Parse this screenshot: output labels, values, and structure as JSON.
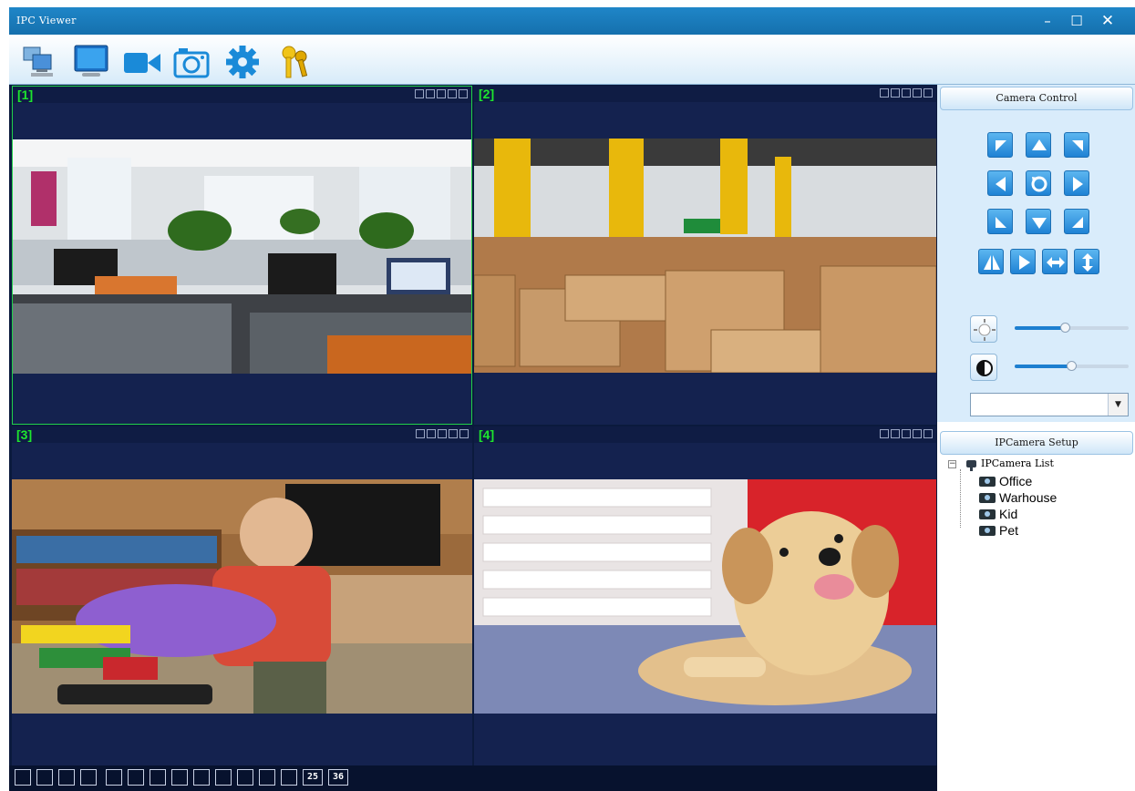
{
  "window": {
    "title": "IPC Viewer",
    "controls": {
      "minimize": "–",
      "maximize": "☐",
      "close": "✕"
    }
  },
  "toolbar": {
    "tools": [
      {
        "icon": "network-computers-icon"
      },
      {
        "icon": "monitor-icon"
      },
      {
        "icon": "video-camera-icon"
      },
      {
        "icon": "snapshot-camera-icon"
      },
      {
        "icon": "settings-gear-icon"
      },
      {
        "icon": "keys-icon"
      }
    ]
  },
  "panes": [
    {
      "number": "[1]",
      "scene": "office",
      "selected": true
    },
    {
      "number": "[2]",
      "scene": "warehouse",
      "selected": false
    },
    {
      "number": "[3]",
      "scene": "kid",
      "selected": false
    },
    {
      "number": "[4]",
      "scene": "pet",
      "selected": false
    }
  ],
  "layout_bar": {
    "buttons": [
      "",
      "",
      "",
      "",
      "",
      "",
      "",
      "",
      "",
      "",
      "",
      "",
      "",
      "25",
      "36"
    ]
  },
  "camera_control": {
    "title": "Camera Control",
    "ptz_buttons": [
      "up-left",
      "up",
      "up-right",
      "left",
      "center-reset",
      "right",
      "down-left",
      "down",
      "down-right",
      "flip",
      "mirror",
      "horizontal-patrol",
      "vertical-patrol"
    ],
    "brightness_level": 0.45,
    "contrast_level": 0.5,
    "preset_value": ""
  },
  "setup": {
    "title": "IPCamera Setup",
    "root_label": "IPCamera List",
    "cameras": [
      "Office",
      "Warhouse",
      "Kid",
      "Pet"
    ]
  },
  "colors": {
    "accent": "#1f86c8",
    "pane_bg": "#14224f",
    "selected_border": "#21d04a",
    "pane_number": "#1ee62e"
  }
}
